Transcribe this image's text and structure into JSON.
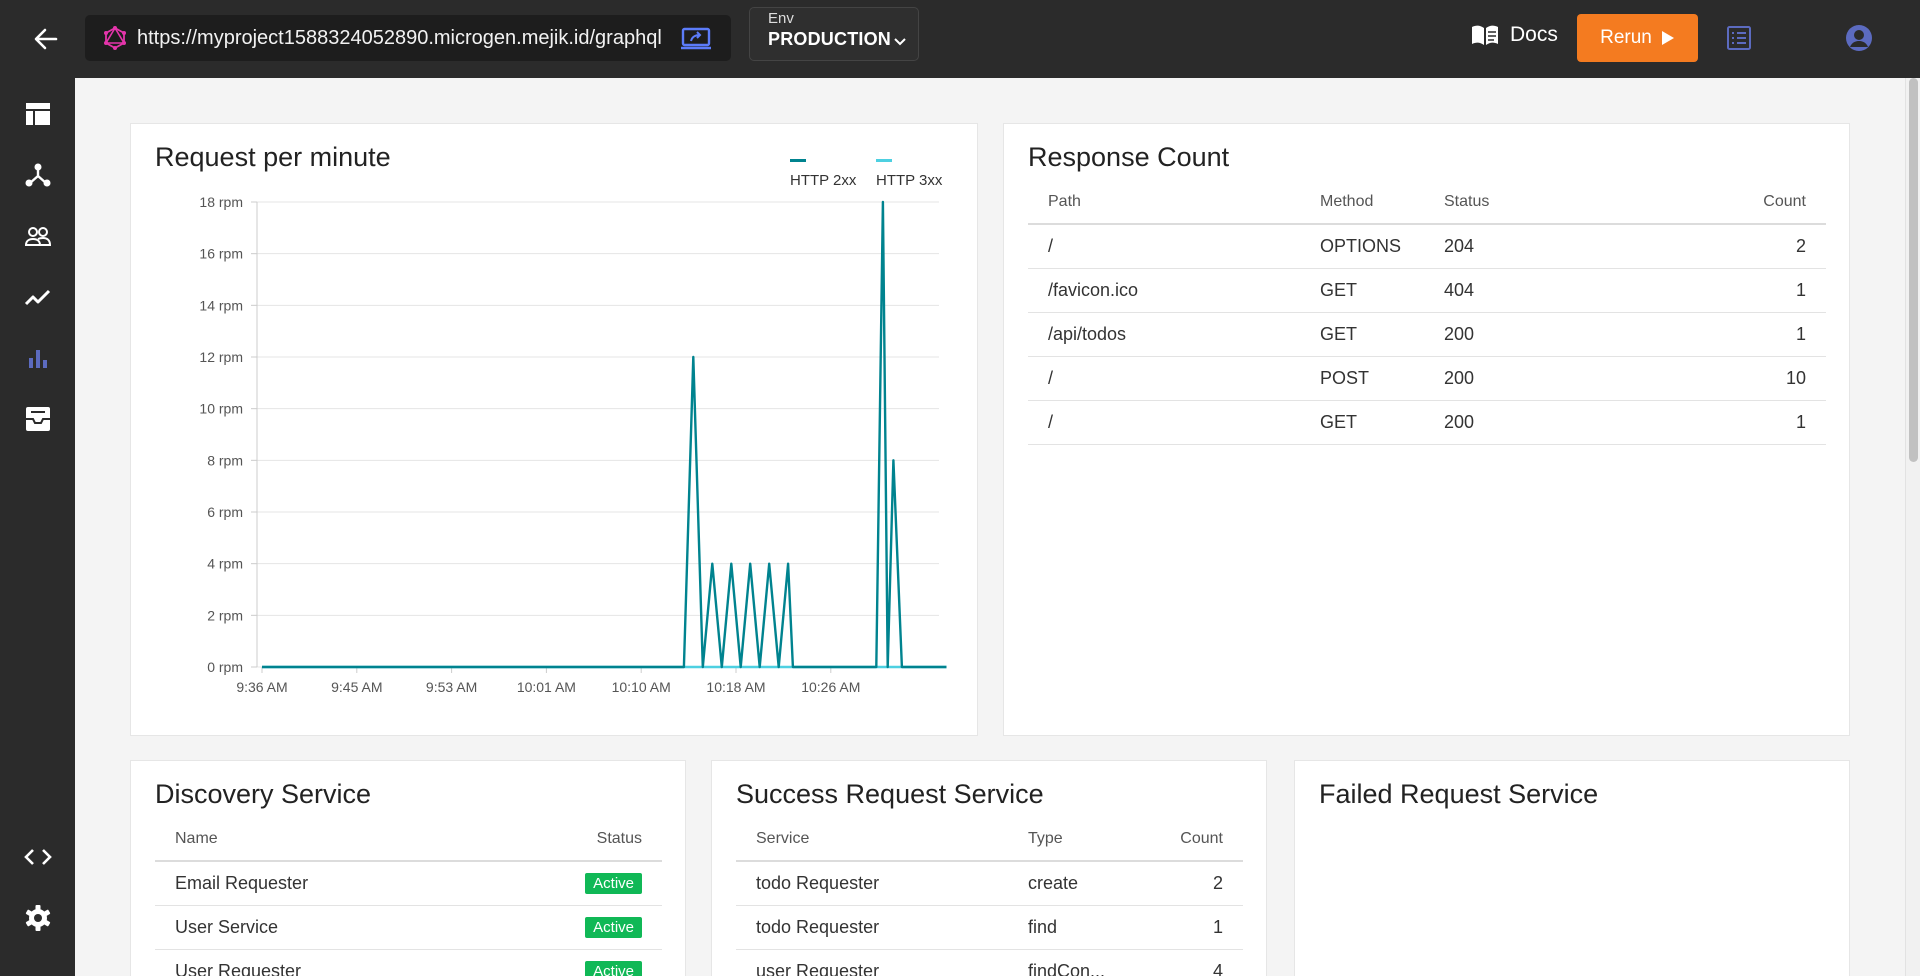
{
  "topbar": {
    "url": "https://myproject1588324052890.microgen.mejik.id/graphql",
    "env_label": "Env",
    "env_value": "PRODUCTION",
    "docs_label": "Docs",
    "rerun_label": "Rerun"
  },
  "sidebar": {
    "items": [
      "dashboard-icon",
      "network-icon",
      "users-icon",
      "trend-icon",
      "bar-chart-icon",
      "inbox-icon"
    ],
    "bottom": [
      "code-icon",
      "gear-icon"
    ]
  },
  "colors": {
    "topbar": "#2b2b2b",
    "rerun": "#f47b20",
    "accent": "#3f51b5",
    "http2xx": "#00838f",
    "http3xx": "#4dd0e1",
    "active_badge": "#10b856"
  },
  "rpm_card": {
    "title": "Request per minute"
  },
  "chart_data": {
    "type": "line",
    "title": "Request per minute",
    "yticks": [
      "0 rpm",
      "2 rpm",
      "4 rpm",
      "6 rpm",
      "8 rpm",
      "10 rpm",
      "12 rpm",
      "14 rpm",
      "16 rpm",
      "18 rpm"
    ],
    "xticks": [
      "9:36 AM",
      "9:45 AM",
      "9:53 AM",
      "10:01 AM",
      "10:10 AM",
      "10:18 AM",
      "10:26 AM"
    ],
    "ylim": [
      0,
      18
    ],
    "xlim": [
      0,
      7.22
    ],
    "grid": true,
    "legend": "top-right",
    "series": [
      {
        "name": "HTTP 2xx",
        "color": "#00838f",
        "x": [
          0,
          4.45,
          4.55,
          4.65,
          4.75,
          4.85,
          4.95,
          5.05,
          5.15,
          5.25,
          5.35,
          5.45,
          5.55,
          5.6,
          6.4,
          6.48,
          6.55,
          6.6,
          6.66,
          6.75,
          7.22
        ],
        "y": [
          0,
          0,
          12,
          0,
          4,
          0,
          4,
          0,
          4,
          0,
          4,
          0,
          4,
          0,
          0,
          0,
          18,
          0,
          8,
          0,
          0
        ]
      },
      {
        "name": "HTTP 3xx",
        "color": "#4dd0e1",
        "x": [
          0,
          7.22
        ],
        "y": [
          0,
          0
        ]
      }
    ]
  },
  "response_card": {
    "title": "Response Count",
    "columns": [
      "Path",
      "Method",
      "Status",
      "Count"
    ],
    "rows": [
      {
        "path": "/",
        "method": "OPTIONS",
        "status": "204",
        "count": "2"
      },
      {
        "path": "/favicon.ico",
        "method": "GET",
        "status": "404",
        "count": "1"
      },
      {
        "path": "/api/todos",
        "method": "GET",
        "status": "200",
        "count": "1"
      },
      {
        "path": "/",
        "method": "POST",
        "status": "200",
        "count": "10"
      },
      {
        "path": "/",
        "method": "GET",
        "status": "200",
        "count": "1"
      }
    ]
  },
  "discovery_card": {
    "title": "Discovery Service",
    "columns": [
      "Name",
      "Status"
    ],
    "rows": [
      {
        "name": "Email Requester",
        "status": "Active"
      },
      {
        "name": "User Service",
        "status": "Active"
      },
      {
        "name": "User Requester",
        "status": "Active"
      }
    ]
  },
  "success_card": {
    "title": "Success Request Service",
    "columns": [
      "Service",
      "Type",
      "Count"
    ],
    "rows": [
      {
        "service": "todo Requester",
        "type": "create",
        "count": "2"
      },
      {
        "service": "todo Requester",
        "type": "find",
        "count": "1"
      },
      {
        "service": "user Requester",
        "type": "findCon...",
        "count": "4"
      }
    ]
  },
  "failed_card": {
    "title": "Failed Request Service"
  }
}
